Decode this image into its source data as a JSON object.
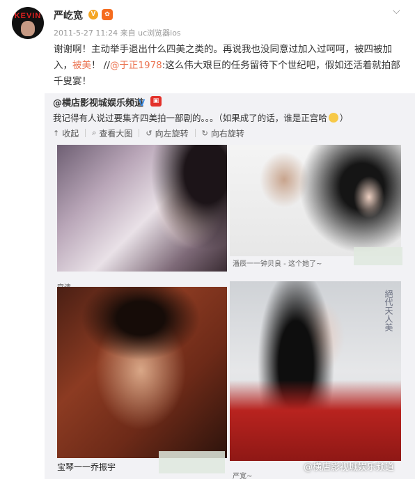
{
  "post": {
    "author": "严屹宽",
    "avatar_logo": "KEVIN",
    "verified_mark": "V",
    "medal_icon": "medal-icon",
    "time": "2011-5-27 11:24",
    "source": "来自 uc浏览器ios",
    "text_before": "谢谢啊！主动举手退出什么四美之类的。再说我也没同意过加入过呵呵，被四被加入，",
    "hot_word": "被美",
    "text_mid": "！ //",
    "mention": "@于正1978",
    "text_after": ":这么伟大艰巨的任务留待下个世纪吧，假如还活着就拍部千叟宴！"
  },
  "repost": {
    "source_name": "@横店影视城娱乐频道",
    "verified_mark": "V",
    "text": "我记得有人说过要集齐四美拍一部剧的。。。（如果成了的话，谁是正宫哈",
    "text_end": "）",
    "toolbar": {
      "collect": "收起",
      "view_large": "查看大图",
      "rotate_left": "向左旋转",
      "rotate_right": "向右旋转"
    },
    "captions": {
      "top_right": "潘辰一一钟贝良 - 这个她了~",
      "bottom_left": "宝琴一一乔振宇",
      "bottom_right": "严宽~"
    },
    "watermark": "@横店影视城娱乐频道",
    "calligraphy": "絕代天人美"
  }
}
